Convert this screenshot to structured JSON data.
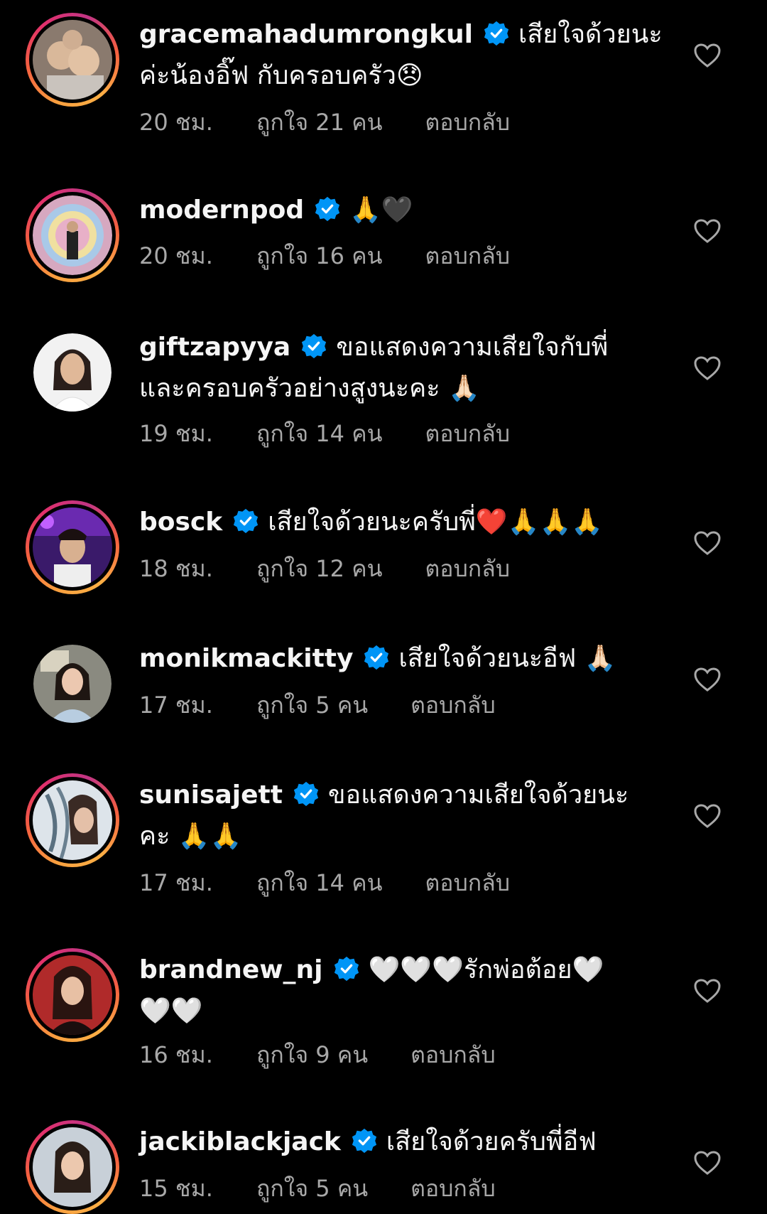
{
  "colors": {
    "background": "#000000",
    "text": "#f5f5f5",
    "meta": "#a8a8a8",
    "verified": "#0095f6"
  },
  "comments": [
    {
      "username": "gracemahadumrongkul",
      "text_line1": "เสียใจด้วยนะ",
      "text_line2": "ค่ะน้องอิ๊ฟ กับครอบครัว😞",
      "time": "20 ชม.",
      "likes": "ถูกใจ 21 คน",
      "reply": "ตอบกลับ",
      "avatar_ring": true
    },
    {
      "username": "modernpod",
      "text_line1": "🙏🖤",
      "time": "20 ชม.",
      "likes": "ถูกใจ 16 คน",
      "reply": "ตอบกลับ",
      "avatar_ring": true
    },
    {
      "username": "giftzapyya",
      "text_line1": "ขอแสดงความเสียใจกับพี่",
      "text_line2": "และครอบครัวอย่างสูงนะคะ 🙏🏻",
      "time": "19 ชม.",
      "likes": "ถูกใจ 14 คน",
      "reply": "ตอบกลับ",
      "avatar_ring": false
    },
    {
      "username": "bosck",
      "text_line1": "เสียใจด้วยนะครับพี่❤️🙏🙏🙏",
      "time": "18 ชม.",
      "likes": "ถูกใจ 12 คน",
      "reply": "ตอบกลับ",
      "avatar_ring": true
    },
    {
      "username": "monikmackitty",
      "text_line1": "เสียใจด้วยนะอีฟ 🙏🏻",
      "time": "17 ชม.",
      "likes": "ถูกใจ 5 คน",
      "reply": "ตอบกลับ",
      "avatar_ring": false
    },
    {
      "username": "sunisajett",
      "text_line1": "ขอแสดงความเสียใจด้วยนะ",
      "text_line2": "คะ 🙏🙏",
      "time": "17 ชม.",
      "likes": "ถูกใจ 14 คน",
      "reply": "ตอบกลับ",
      "avatar_ring": true
    },
    {
      "username": "brandnew_nj",
      "text_line1": "🤍🤍🤍รักพ่อต้อย🤍",
      "text_line2": "🤍🤍",
      "time": "16 ชม.",
      "likes": "ถูกใจ 9 คน",
      "reply": "ตอบกลับ",
      "avatar_ring": true
    },
    {
      "username": "jackiblackjack",
      "text_line1": "เสียใจด้วยครับพี่อีฟ",
      "time": "15 ชม.",
      "likes": "ถูกใจ 5 คน",
      "reply": "ตอบกลับ",
      "avatar_ring": true
    }
  ]
}
